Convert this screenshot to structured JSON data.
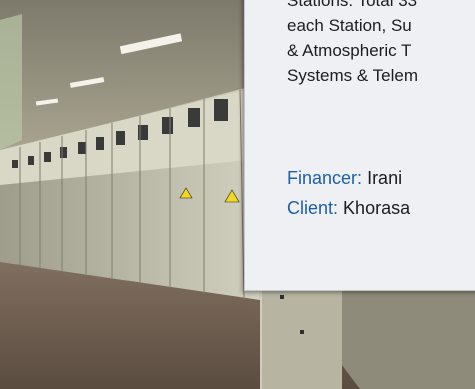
{
  "info_panel": {
    "lines": [
      "Stations: Total 33",
      "each Station, Su",
      "& Atmospheric T",
      "Systems & Telem"
    ],
    "financer_label": "Financer:",
    "financer_value": "Irani",
    "client_label": "Client:",
    "client_value": "Khorasa"
  },
  "colors": {
    "label_blue": "#1e5fa8",
    "panel_bg": "#eef0f3",
    "cabinet_grey": "#c9c9b8",
    "warning_yellow": "#f2d81f"
  }
}
